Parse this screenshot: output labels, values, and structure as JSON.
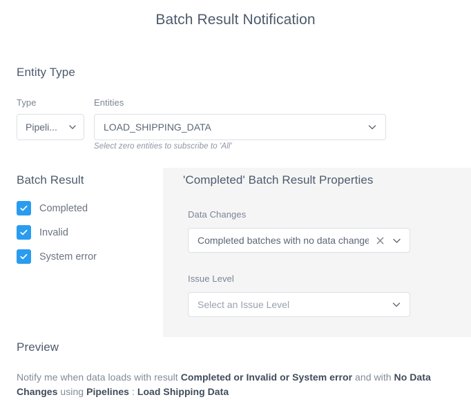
{
  "page": {
    "title": "Batch Result Notification"
  },
  "entity_type": {
    "heading": "Entity Type",
    "type_field": {
      "label": "Type",
      "value": "Pipeli...",
      "chevron_icon": "chevron-down-icon"
    },
    "entities_field": {
      "label": "Entities",
      "value": "LOAD_SHIPPING_DATA",
      "chevron_icon": "chevron-down-icon",
      "hint": "Select zero entities to subscribe to 'All'"
    }
  },
  "batch_result": {
    "heading": "Batch Result",
    "options": [
      {
        "label": "Completed",
        "checked": true
      },
      {
        "label": "Invalid",
        "checked": true
      },
      {
        "label": "System error",
        "checked": true
      }
    ],
    "checkbox_color": "#2a9cf0",
    "check_icon": "checkmark-icon"
  },
  "properties_panel": {
    "heading": "'Completed' Batch Result Properties",
    "background_color": "#f5f5f6",
    "data_changes": {
      "label": "Data Changes",
      "value": "Completed batches with no data changes",
      "clear_icon": "close-icon",
      "chevron_icon": "chevron-down-icon"
    },
    "issue_level": {
      "label": "Issue Level",
      "placeholder": "Select an Issue Level",
      "value": "",
      "chevron_icon": "chevron-down-icon"
    }
  },
  "preview": {
    "heading": "Preview",
    "segments": [
      {
        "text": "Notify me when data loads with result ",
        "bold": false
      },
      {
        "text": "Completed or Invalid or System error",
        "bold": true
      },
      {
        "text": " and with ",
        "bold": false
      },
      {
        "text": "No Data Changes",
        "bold": true
      },
      {
        "text": " using ",
        "bold": false
      },
      {
        "text": "Pipelines",
        "bold": true
      },
      {
        "text": " : ",
        "bold": false
      },
      {
        "text": "Load Shipping Data",
        "bold": true
      }
    ]
  }
}
